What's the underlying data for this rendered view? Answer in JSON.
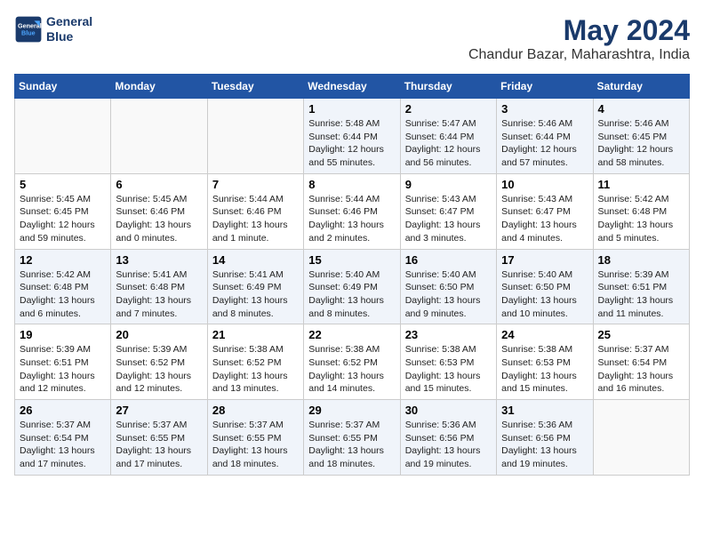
{
  "header": {
    "logo_line1": "General",
    "logo_line2": "Blue",
    "title": "May 2024",
    "subtitle": "Chandur Bazar, Maharashtra, India"
  },
  "days_of_week": [
    "Sunday",
    "Monday",
    "Tuesday",
    "Wednesday",
    "Thursday",
    "Friday",
    "Saturday"
  ],
  "weeks": [
    [
      {
        "day": "",
        "info": ""
      },
      {
        "day": "",
        "info": ""
      },
      {
        "day": "",
        "info": ""
      },
      {
        "day": "1",
        "info": "Sunrise: 5:48 AM\nSunset: 6:44 PM\nDaylight: 12 hours\nand 55 minutes."
      },
      {
        "day": "2",
        "info": "Sunrise: 5:47 AM\nSunset: 6:44 PM\nDaylight: 12 hours\nand 56 minutes."
      },
      {
        "day": "3",
        "info": "Sunrise: 5:46 AM\nSunset: 6:44 PM\nDaylight: 12 hours\nand 57 minutes."
      },
      {
        "day": "4",
        "info": "Sunrise: 5:46 AM\nSunset: 6:45 PM\nDaylight: 12 hours\nand 58 minutes."
      }
    ],
    [
      {
        "day": "5",
        "info": "Sunrise: 5:45 AM\nSunset: 6:45 PM\nDaylight: 12 hours\nand 59 minutes."
      },
      {
        "day": "6",
        "info": "Sunrise: 5:45 AM\nSunset: 6:46 PM\nDaylight: 13 hours\nand 0 minutes."
      },
      {
        "day": "7",
        "info": "Sunrise: 5:44 AM\nSunset: 6:46 PM\nDaylight: 13 hours\nand 1 minute."
      },
      {
        "day": "8",
        "info": "Sunrise: 5:44 AM\nSunset: 6:46 PM\nDaylight: 13 hours\nand 2 minutes."
      },
      {
        "day": "9",
        "info": "Sunrise: 5:43 AM\nSunset: 6:47 PM\nDaylight: 13 hours\nand 3 minutes."
      },
      {
        "day": "10",
        "info": "Sunrise: 5:43 AM\nSunset: 6:47 PM\nDaylight: 13 hours\nand 4 minutes."
      },
      {
        "day": "11",
        "info": "Sunrise: 5:42 AM\nSunset: 6:48 PM\nDaylight: 13 hours\nand 5 minutes."
      }
    ],
    [
      {
        "day": "12",
        "info": "Sunrise: 5:42 AM\nSunset: 6:48 PM\nDaylight: 13 hours\nand 6 minutes."
      },
      {
        "day": "13",
        "info": "Sunrise: 5:41 AM\nSunset: 6:48 PM\nDaylight: 13 hours\nand 7 minutes."
      },
      {
        "day": "14",
        "info": "Sunrise: 5:41 AM\nSunset: 6:49 PM\nDaylight: 13 hours\nand 8 minutes."
      },
      {
        "day": "15",
        "info": "Sunrise: 5:40 AM\nSunset: 6:49 PM\nDaylight: 13 hours\nand 8 minutes."
      },
      {
        "day": "16",
        "info": "Sunrise: 5:40 AM\nSunset: 6:50 PM\nDaylight: 13 hours\nand 9 minutes."
      },
      {
        "day": "17",
        "info": "Sunrise: 5:40 AM\nSunset: 6:50 PM\nDaylight: 13 hours\nand 10 minutes."
      },
      {
        "day": "18",
        "info": "Sunrise: 5:39 AM\nSunset: 6:51 PM\nDaylight: 13 hours\nand 11 minutes."
      }
    ],
    [
      {
        "day": "19",
        "info": "Sunrise: 5:39 AM\nSunset: 6:51 PM\nDaylight: 13 hours\nand 12 minutes."
      },
      {
        "day": "20",
        "info": "Sunrise: 5:39 AM\nSunset: 6:52 PM\nDaylight: 13 hours\nand 12 minutes."
      },
      {
        "day": "21",
        "info": "Sunrise: 5:38 AM\nSunset: 6:52 PM\nDaylight: 13 hours\nand 13 minutes."
      },
      {
        "day": "22",
        "info": "Sunrise: 5:38 AM\nSunset: 6:52 PM\nDaylight: 13 hours\nand 14 minutes."
      },
      {
        "day": "23",
        "info": "Sunrise: 5:38 AM\nSunset: 6:53 PM\nDaylight: 13 hours\nand 15 minutes."
      },
      {
        "day": "24",
        "info": "Sunrise: 5:38 AM\nSunset: 6:53 PM\nDaylight: 13 hours\nand 15 minutes."
      },
      {
        "day": "25",
        "info": "Sunrise: 5:37 AM\nSunset: 6:54 PM\nDaylight: 13 hours\nand 16 minutes."
      }
    ],
    [
      {
        "day": "26",
        "info": "Sunrise: 5:37 AM\nSunset: 6:54 PM\nDaylight: 13 hours\nand 17 minutes."
      },
      {
        "day": "27",
        "info": "Sunrise: 5:37 AM\nSunset: 6:55 PM\nDaylight: 13 hours\nand 17 minutes."
      },
      {
        "day": "28",
        "info": "Sunrise: 5:37 AM\nSunset: 6:55 PM\nDaylight: 13 hours\nand 18 minutes."
      },
      {
        "day": "29",
        "info": "Sunrise: 5:37 AM\nSunset: 6:55 PM\nDaylight: 13 hours\nand 18 minutes."
      },
      {
        "day": "30",
        "info": "Sunrise: 5:36 AM\nSunset: 6:56 PM\nDaylight: 13 hours\nand 19 minutes."
      },
      {
        "day": "31",
        "info": "Sunrise: 5:36 AM\nSunset: 6:56 PM\nDaylight: 13 hours\nand 19 minutes."
      },
      {
        "day": "",
        "info": ""
      }
    ]
  ]
}
